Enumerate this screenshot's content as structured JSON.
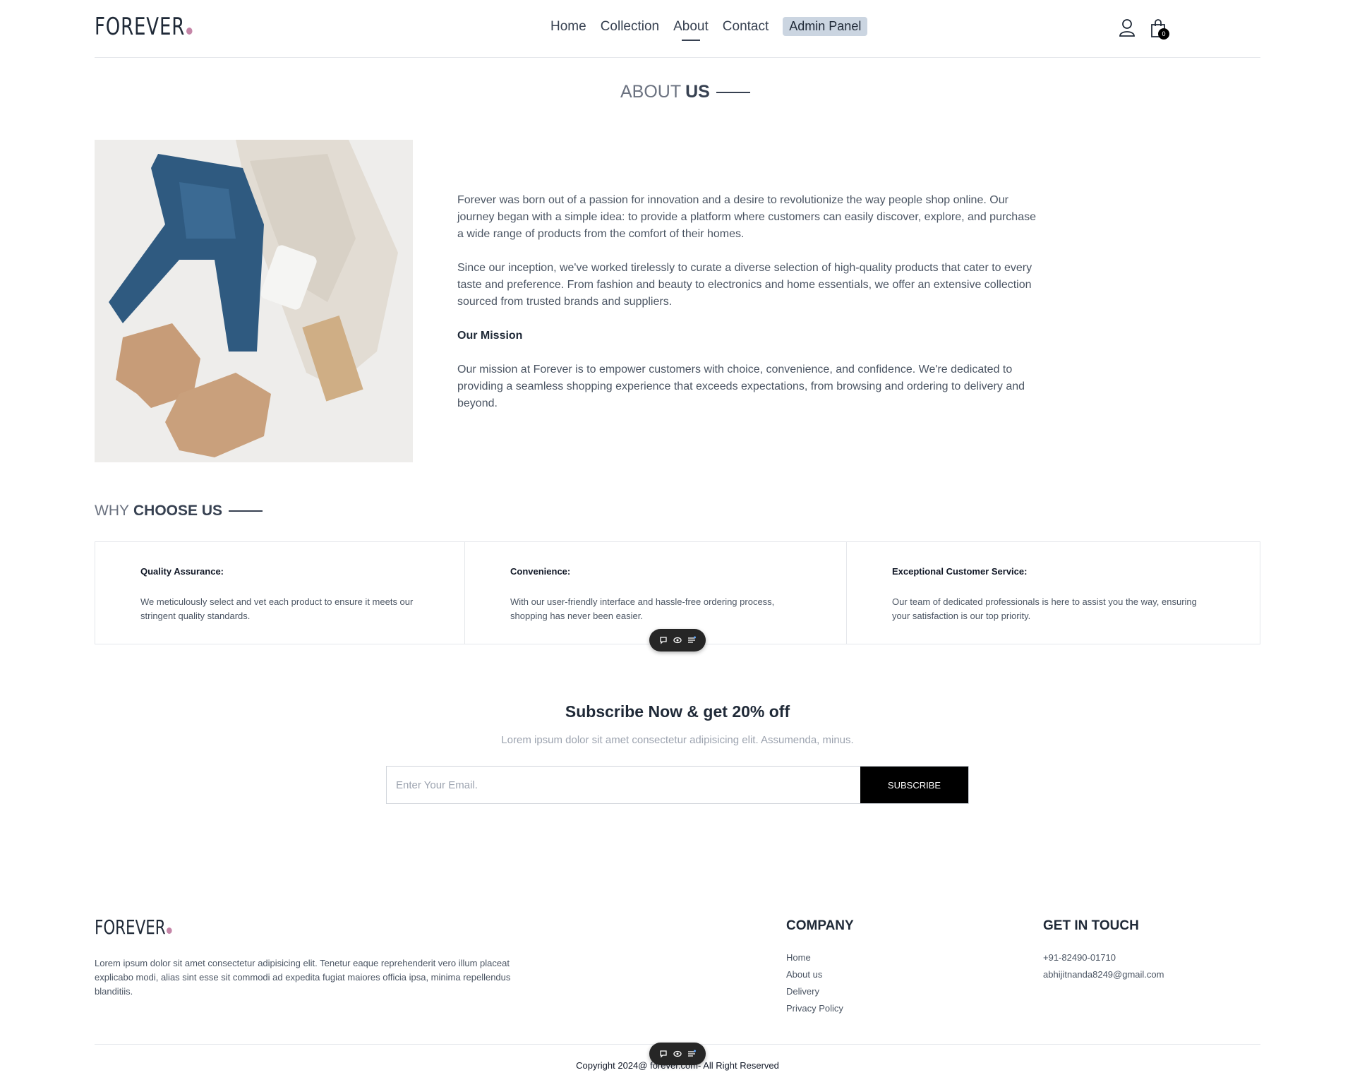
{
  "header": {
    "logo": "FOREVER",
    "nav": [
      "Home",
      "Collection",
      "About",
      "Contact"
    ],
    "admin_label": "Admin Panel",
    "cart_count": "0"
  },
  "about": {
    "title_light": "ABOUT",
    "title_bold": "US",
    "para1": "Forever was born out of a passion for innovation and a desire to revolutionize the way people shop online. Our journey began with a simple idea: to provide a platform where customers can easily discover, explore, and purchase a wide range of products from the comfort of their homes.",
    "para2": "Since our inception, we've worked tirelessly to curate a diverse selection of high-quality products that cater to every taste and preference. From fashion and beauty to electronics and home essentials, we offer an extensive collection sourced from trusted brands and suppliers.",
    "mission_heading": "Our Mission",
    "mission_text": "Our mission at Forever is to empower customers with choice, convenience, and confidence. We're dedicated to providing a seamless shopping experience that exceeds expectations, from browsing and ordering to delivery and beyond."
  },
  "why": {
    "title_light": "WHY",
    "title_bold": "CHOOSE US",
    "cards": [
      {
        "title": "Quality Assurance:",
        "text": "We meticulously select and vet each product to ensure it meets our stringent quality standards."
      },
      {
        "title": "Convenience:",
        "text": "With our user-friendly interface and hassle-free ordering process, shopping has never been easier."
      },
      {
        "title": "Exceptional Customer Service:",
        "text": "Our team of dedicated professionals is here to assist you the way, ensuring your satisfaction is our top priority."
      }
    ]
  },
  "subscribe": {
    "title": "Subscribe Now & get 20% off",
    "desc": "Lorem ipsum dolor sit amet consectetur adipisicing elit. Assumenda, minus.",
    "placeholder": "Enter Your Email.",
    "button": "SUBSCRIBE"
  },
  "footer": {
    "logo": "FOREVER",
    "desc": "Lorem ipsum dolor sit amet consectetur adipisicing elit. Tenetur eaque reprehenderit vero illum placeat explicabo modi, alias sint esse sit commodi ad expedita fugiat maiores officia ipsa, minima repellendus blanditiis.",
    "company_title": "COMPANY",
    "company_links": [
      "Home",
      "About us",
      "Delivery",
      "Privacy Policy"
    ],
    "contact_title": "GET IN TOUCH",
    "phone": "+91-82490-01710",
    "email": "abhijitnanda8249@gmail.com",
    "copyright": "Copyright 2024@ forever.com- All Right Reserved"
  }
}
